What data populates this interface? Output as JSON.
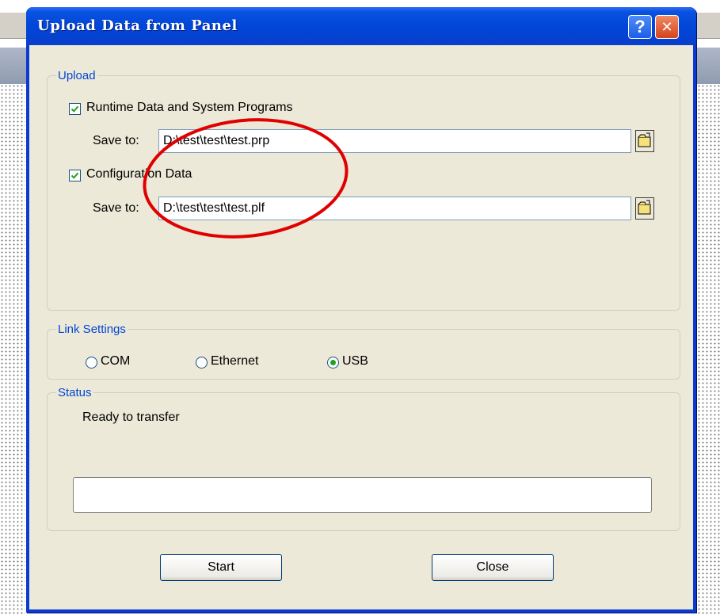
{
  "dialog": {
    "title": "Upload Data from Panel",
    "help_glyph": "?",
    "close_glyph": "✕"
  },
  "upload": {
    "legend": "Upload",
    "runtime": {
      "label": "Runtime Data and System Programs",
      "checked": true,
      "save_to_label": "Save to:",
      "path": "D:\\test\\test\\test.prp"
    },
    "config": {
      "label": "Configuration Data",
      "checked": true,
      "save_to_label": "Save to:",
      "path": "D:\\test\\test\\test.plf"
    }
  },
  "link": {
    "legend": "Link Settings",
    "options": [
      "COM",
      "Ethernet",
      "USB"
    ],
    "selected": "USB"
  },
  "status": {
    "legend": "Status",
    "text": "Ready to transfer",
    "progress_percent": 0
  },
  "buttons": {
    "start": "Start",
    "close": "Close"
  },
  "colors": {
    "titlebar": "#0046d8",
    "client_bg": "#ece9d8",
    "groupbox_legend": "#0046d5",
    "annotation": "#e00000",
    "radio_selected": "#21a121"
  },
  "icons": [
    "help-icon",
    "close-icon",
    "check-icon",
    "folder-browse-icon"
  ]
}
